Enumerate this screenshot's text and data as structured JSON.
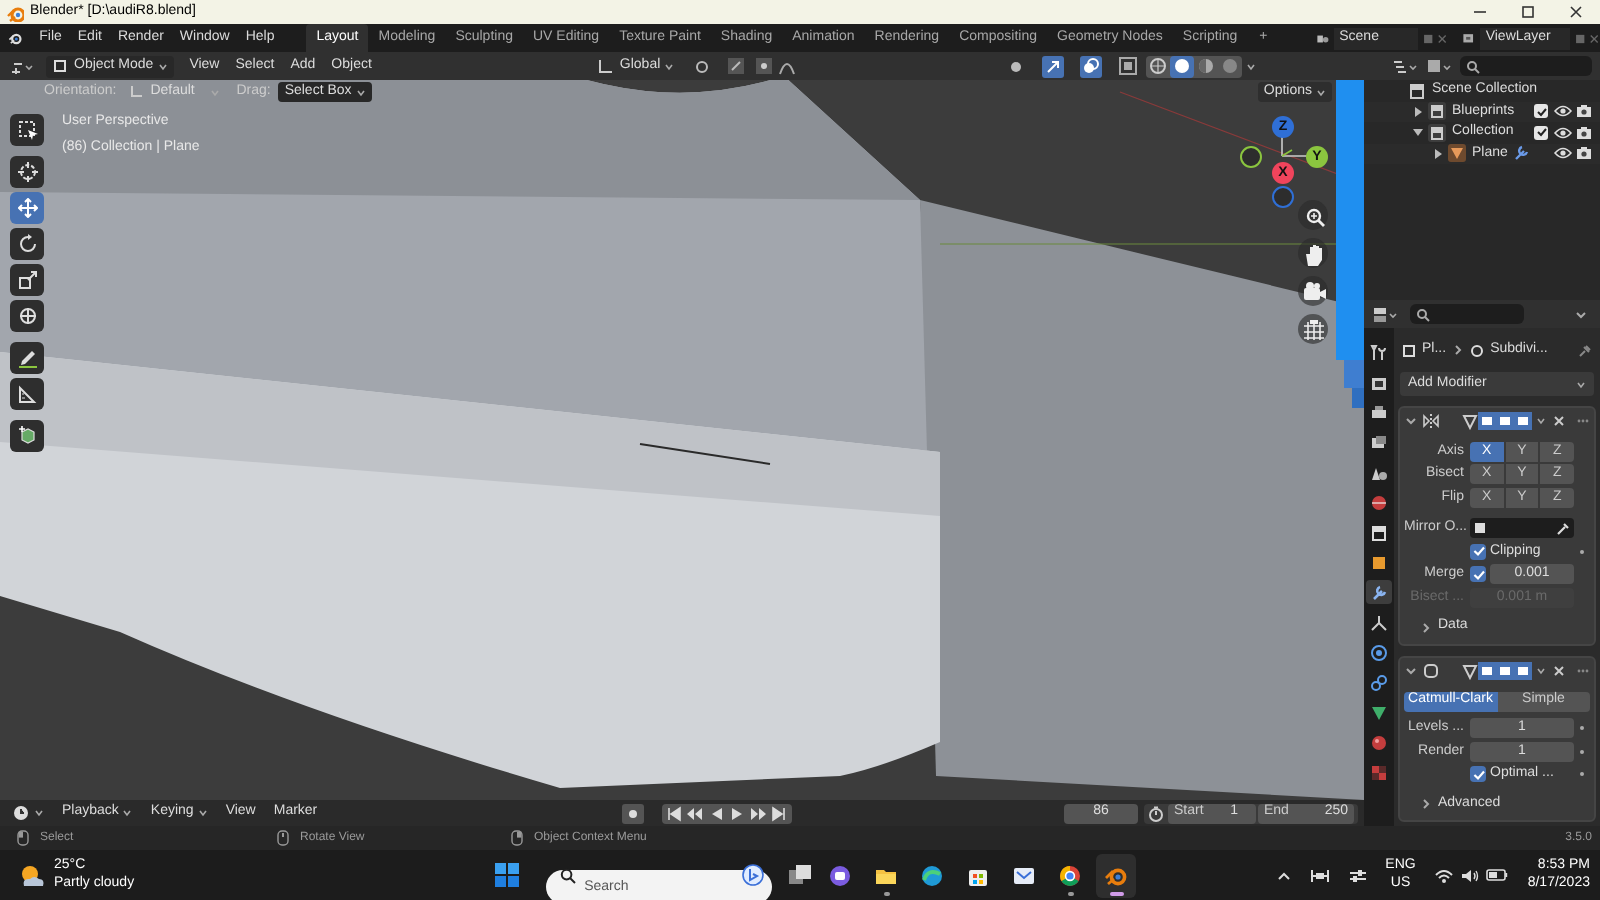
{
  "window": {
    "title": "Blender* [D:\\audiR8.blend]"
  },
  "menu_bar": {
    "menus": [
      "File",
      "Edit",
      "Render",
      "Window",
      "Help"
    ],
    "workspace_tabs": [
      {
        "label": "Layout",
        "selected": true
      },
      {
        "label": "Modeling",
        "selected": false
      },
      {
        "label": "Sculpting",
        "selected": false
      },
      {
        "label": "UV Editing",
        "selected": false
      },
      {
        "label": "Texture Paint",
        "selected": false
      },
      {
        "label": "Shading",
        "selected": false
      },
      {
        "label": "Animation",
        "selected": false
      },
      {
        "label": "Rendering",
        "selected": false
      },
      {
        "label": "Compositing",
        "selected": false
      },
      {
        "label": "Geometry Nodes",
        "selected": false
      },
      {
        "label": "Scripting",
        "selected": false
      }
    ],
    "add_workspace": "+",
    "scene": "Scene",
    "view_layer": "ViewLayer"
  },
  "viewport": {
    "mode": "Object Mode",
    "menus": [
      "View",
      "Select",
      "Add",
      "Object"
    ],
    "transform_orientation": "Global",
    "shading": [
      {
        "kind": "wireframe",
        "selected": false
      },
      {
        "kind": "solid",
        "selected": true
      },
      {
        "kind": "material",
        "selected": false
      },
      {
        "kind": "rendered",
        "selected": false
      }
    ],
    "orientation_label": "Orientation:",
    "orientation": "Default",
    "drag_label": "Drag:",
    "drag": "Select Box",
    "options": "Options",
    "overlay_text": [
      "User Perspective",
      "(86) Collection | Plane"
    ],
    "tool_groups": [
      [
        {
          "kind": "select_box",
          "selected": false
        }
      ],
      [
        {
          "kind": "cursor",
          "selected": false
        },
        {
          "kind": "move",
          "selected": true
        },
        {
          "kind": "rotate",
          "selected": false
        },
        {
          "kind": "scale",
          "selected": false
        },
        {
          "kind": "transform",
          "selected": false
        }
      ],
      [
        {
          "kind": "annotate",
          "selected": false
        },
        {
          "kind": "measure",
          "selected": false
        }
      ],
      [
        {
          "kind": "add_cube",
          "selected": false
        }
      ]
    ],
    "gizmo": [
      {
        "kind": "positive",
        "label": "Z",
        "color": "#2f6fd6"
      },
      {
        "kind": "positive",
        "label": "Y",
        "color": "#8bc53f"
      },
      {
        "kind": "positive",
        "label": "X",
        "color": "#f0445c"
      },
      {
        "kind": "negative",
        "color": "#8bc53f"
      },
      {
        "kind": "negative",
        "color": "#2f6fd6"
      }
    ]
  },
  "outliner": {
    "items": [
      {
        "label": "Scene Collection",
        "kind": "scene_collection",
        "children": [
          {
            "label": "Blueprints",
            "kind": "collection",
            "expanded": false,
            "included": true
          },
          {
            "label": "Collection",
            "kind": "collection",
            "expanded": true,
            "included": true,
            "children": [
              {
                "label": "Plane",
                "kind": "object",
                "expanded": false
              }
            ]
          }
        ]
      }
    ]
  },
  "properties": {
    "tabs": [
      {
        "kind": "tool",
        "selected": false
      },
      {
        "kind": "render",
        "selected": false
      },
      {
        "kind": "output",
        "selected": false
      },
      {
        "kind": "view_layer",
        "selected": false
      },
      {
        "kind": "scene",
        "selected": false
      },
      {
        "kind": "world",
        "selected": false
      },
      {
        "kind": "collection",
        "selected": false
      },
      {
        "kind": "object",
        "selected": false
      },
      {
        "kind": "modifiers",
        "selected": true
      },
      {
        "kind": "particles",
        "selected": false
      },
      {
        "kind": "physics",
        "selected": false
      },
      {
        "kind": "constraints",
        "selected": false
      },
      {
        "kind": "data",
        "selected": false
      },
      {
        "kind": "material",
        "selected": false
      },
      {
        "kind": "texture",
        "selected": false
      }
    ],
    "breadcrumb": [
      "Pl...",
      "Subdivi..."
    ],
    "add_modifier": "Add Modifier",
    "modifiers": [
      {
        "kind": "mirror",
        "expanded": true,
        "axis_rows": [
          {
            "label": "Axis",
            "buttons": [
              {
                "label": "X",
                "selected": true
              },
              {
                "label": "Y",
                "selected": false
              },
              {
                "label": "Z",
                "selected": false
              }
            ]
          },
          {
            "label": "Bisect",
            "buttons": [
              {
                "label": "X",
                "selected": false
              },
              {
                "label": "Y",
                "selected": false
              },
              {
                "label": "Z",
                "selected": false
              }
            ]
          },
          {
            "label": "Flip",
            "buttons": [
              {
                "label": "X",
                "selected": false
              },
              {
                "label": "Y",
                "selected": false
              },
              {
                "label": "Z",
                "selected": false
              }
            ]
          }
        ],
        "mirror_object": {
          "label": "Mirror O..."
        },
        "clipping": {
          "label": "Clipping",
          "checked": true
        },
        "merge": {
          "label": "Merge",
          "checked": true,
          "value": "0.001"
        },
        "bisect_distance": {
          "label": "Bisect ...",
          "value": "0.001 m",
          "disabled": true
        },
        "subpanel": {
          "label": "Data",
          "expanded": false
        }
      },
      {
        "kind": "subdivision",
        "expanded": true,
        "methods": [
          {
            "label": "Catmull-Clark",
            "selected": true
          },
          {
            "label": "Simple",
            "selected": false
          }
        ],
        "fields": [
          {
            "label": "Levels ...",
            "value": "1"
          },
          {
            "label": "Render",
            "value": "1"
          }
        ],
        "optimal": {
          "label": "Optimal ...",
          "checked": true
        },
        "subpanel": {
          "label": "Advanced",
          "expanded": false
        }
      }
    ]
  },
  "timeline": {
    "menus": [
      {
        "label": "Playback",
        "dropdown": true
      },
      {
        "label": "Keying",
        "dropdown": true
      },
      {
        "label": "View",
        "dropdown": false
      },
      {
        "label": "Marker",
        "dropdown": false
      }
    ],
    "current_frame": "86",
    "start_label": "Start",
    "start": "1",
    "end_label": "End",
    "end": "250"
  },
  "status_bar": {
    "hints": [
      "Select",
      "Rotate View",
      "Object Context Menu"
    ],
    "version": "3.5.0"
  },
  "taskbar": {
    "temperature": "25°C",
    "weather": "Partly cloudy",
    "search_placeholder": "Search",
    "apps": [
      {
        "kind": "chat",
        "open": false,
        "active": false
      },
      {
        "kind": "folder",
        "open": true,
        "active": false
      },
      {
        "kind": "edge",
        "open": false,
        "active": false
      },
      {
        "kind": "store",
        "open": false,
        "active": false
      },
      {
        "kind": "mail",
        "open": false,
        "active": false
      },
      {
        "kind": "chrome",
        "open": true,
        "active": false
      },
      {
        "kind": "blender",
        "open": true,
        "active": true
      }
    ],
    "language": "ENG",
    "region": "US",
    "time": "8:53 PM",
    "date": "8/17/2023"
  }
}
